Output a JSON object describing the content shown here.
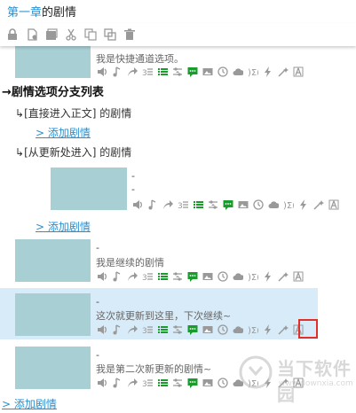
{
  "title": {
    "chapter": "第一章",
    "suffix": "的剧情"
  },
  "toolbar": [
    "lock-icon",
    "new-file-icon",
    "save-icon",
    "cut-icon",
    "copy-icon",
    "duplicate-icon",
    "trash-icon"
  ],
  "shortcut_row": {
    "desc": "我是快捷通道选项。"
  },
  "branch_heading": "剧情选项分支列表",
  "branch1": {
    "prefix": "[",
    "label": "直接进入正文",
    "suffix": "] 的剧情"
  },
  "add_label": "> 添加剧情",
  "branch2": {
    "prefix": "[",
    "label": "从更新处进入",
    "suffix": "] 的剧情"
  },
  "nested_item": {
    "line1": "-",
    "line2": "-"
  },
  "story_items": [
    {
      "dash": "-",
      "desc": "我是继续的剧情"
    },
    {
      "dash": "-",
      "desc": "这次就更新到这里，下次继续~"
    },
    {
      "dash": "-",
      "desc": "我是第二次新更新的剧情~"
    }
  ],
  "watermark": {
    "text": "当下软件园",
    "url": "www.downxia.com"
  },
  "colors": {
    "link": "#2a8fd0",
    "thumb": "#a8cfd4",
    "highlight": "#d8ebf8",
    "icon_green": "#1a9c2c",
    "red_box": "#e0302a"
  }
}
